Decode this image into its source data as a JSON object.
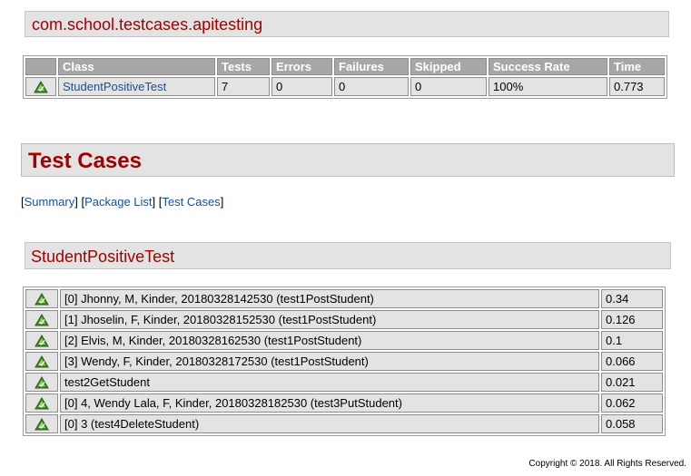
{
  "package": {
    "title": "com.school.testcases.apitesting"
  },
  "summary_table": {
    "headers": [
      "",
      "Class",
      "Tests",
      "Errors",
      "Failures",
      "Skipped",
      "Success Rate",
      "Time"
    ],
    "row": {
      "status_icon": "pass-icon",
      "class": "StudentPositiveTest",
      "tests": "7",
      "errors": "0",
      "failures": "0",
      "skipped": "0",
      "success_rate": "100%",
      "time": "0.773"
    }
  },
  "section": {
    "title": "Test Cases"
  },
  "nav": {
    "open": "[",
    "summary": "Summary",
    "sep1": "] [",
    "package_list": "Package List",
    "sep2": "] [",
    "test_cases": "Test Cases",
    "close": "]"
  },
  "class_section": {
    "title": "StudentPositiveTest"
  },
  "test_cases": [
    {
      "status_icon": "pass-icon",
      "name": "[0] Jhonny, M, Kinder, 20180328142530 (test1PostStudent)",
      "time": "0.34"
    },
    {
      "status_icon": "pass-icon",
      "name": "[1] Jhoselin, F, Kinder, 20180328152530 (test1PostStudent)",
      "time": "0.126"
    },
    {
      "status_icon": "pass-icon",
      "name": "[2] Elvis, M, Kinder, 20180328162530 (test1PostStudent)",
      "time": "0.1"
    },
    {
      "status_icon": "pass-icon",
      "name": "[3] Wendy, F, Kinder, 20180328172530 (test1PostStudent)",
      "time": "0.066"
    },
    {
      "status_icon": "pass-icon",
      "name": "test2GetStudent",
      "time": "0.021"
    },
    {
      "status_icon": "pass-icon",
      "name": "[0] 4, Wendy Lala, F, Kinder, 20180328182530 (test3PutStudent)",
      "time": "0.062"
    },
    {
      "status_icon": "pass-icon",
      "name": "[0] 3 (test4DeleteStudent)",
      "time": "0.058"
    }
  ],
  "footer": {
    "text": "Copyright © 2018. All Rights Reserved."
  },
  "colors": {
    "title_red": "#a50000",
    "link_blue": "#1a4ea2",
    "header_grey": "#a7a7a7",
    "row_grey": "#e3e3e3",
    "pass_green": "#3d8a1e"
  }
}
